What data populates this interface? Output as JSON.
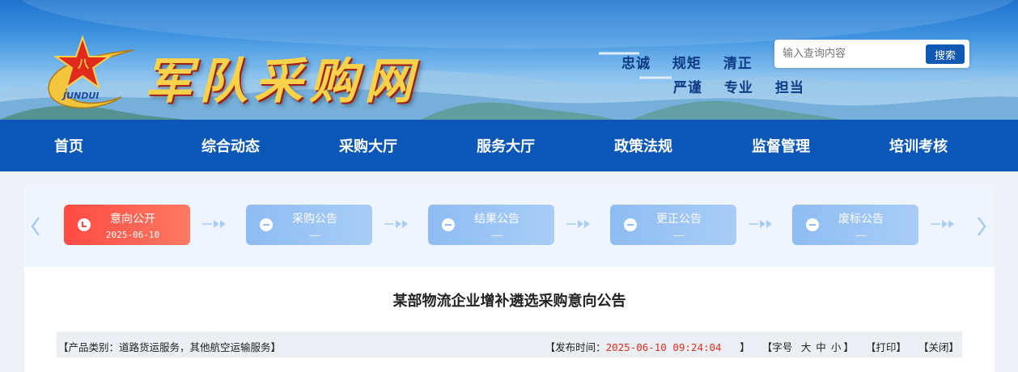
{
  "banner": {
    "site_name": "军队采购网",
    "logo_badge": "八",
    "logo_ring_text": "JUNDUI",
    "slogans_row1": [
      "忠诚",
      "规矩",
      "清正"
    ],
    "slogans_row2": [
      "严谨",
      "专业",
      "担当"
    ]
  },
  "search": {
    "placeholder": "输入查询内容",
    "button_label": "搜索"
  },
  "nav": {
    "items": [
      "首页",
      "综合动态",
      "采购大厅",
      "服务大厅",
      "政策法规",
      "监督管理",
      "培训考核"
    ]
  },
  "steps": [
    {
      "label": "意向公开",
      "date": "2025-06-10",
      "status": "active"
    },
    {
      "label": "采购公告",
      "date": "——",
      "status": "pending"
    },
    {
      "label": "结果公告",
      "date": "——",
      "status": "pending"
    },
    {
      "label": "更正公告",
      "date": "——",
      "status": "pending"
    },
    {
      "label": "废标公告",
      "date": "——",
      "status": "pending"
    }
  ],
  "article": {
    "title": "某部物流企业增补遴选采购意向公告",
    "category_text": "【产品类别：道路货运服务，其他航空运输服务】",
    "publish_prefix": "【发布时间：",
    "publish_time": "2025-06-10 09:24:04",
    "publish_suffix": "】",
    "font_size_prefix": "【字号",
    "font_size_large": "大",
    "font_size_medium": "中",
    "font_size_small": "小",
    "font_size_suffix": "】",
    "print_label": "【打印】",
    "close_label": "【关闭】"
  },
  "colors": {
    "nav_bg": "#0b57b8",
    "active_step": "#ff4a44",
    "pending_step": "#8ebcf3",
    "publish_time": "#e0301e"
  }
}
